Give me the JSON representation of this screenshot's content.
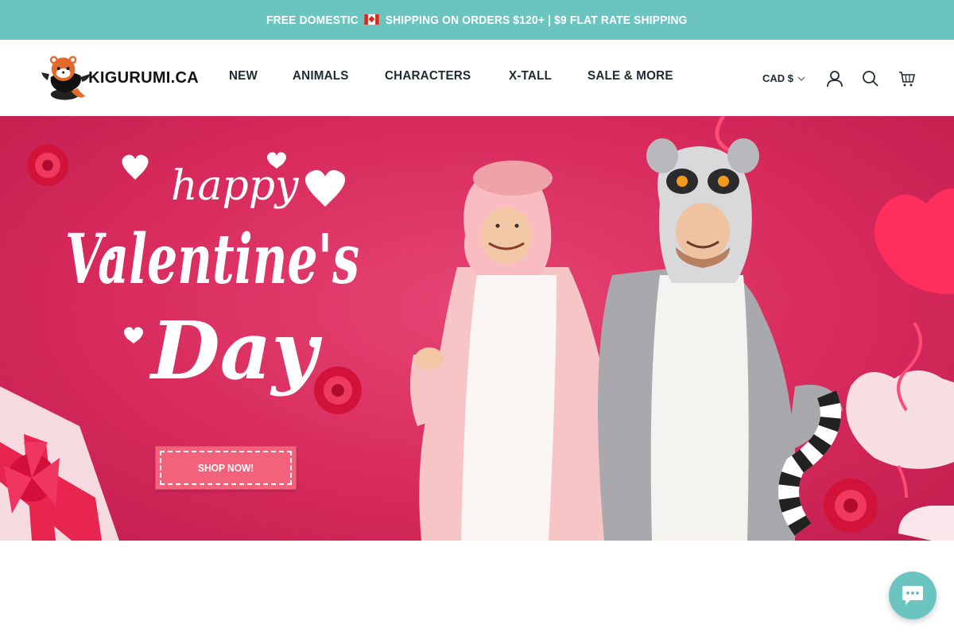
{
  "announcement": {
    "text_before_flag": "FREE DOMESTIC",
    "flag_icon": "canada-flag-icon",
    "text_after_flag": "SHIPPING ON ORDERS $120+ | $9 FLAT RATE SHIPPING",
    "background": "#6cc4c1"
  },
  "header": {
    "logo_text": "KIGURUMI.CA",
    "nav": [
      "NEW",
      "ANIMALS",
      "CHARACTERS",
      "X-TALL",
      "SALE & MORE"
    ],
    "currency": "CAD $",
    "icons": [
      "account-icon",
      "search-icon",
      "cart-icon"
    ]
  },
  "hero": {
    "headline_line1": "happy",
    "headline_line2": "Valentine's",
    "headline_line3": "Day",
    "cta_label": "SHOP NOW!",
    "background": "#d82a5d",
    "cta_color": "#f2637b"
  },
  "chat": {
    "icon": "chat-bubble-icon",
    "color": "#6cc4c1"
  }
}
